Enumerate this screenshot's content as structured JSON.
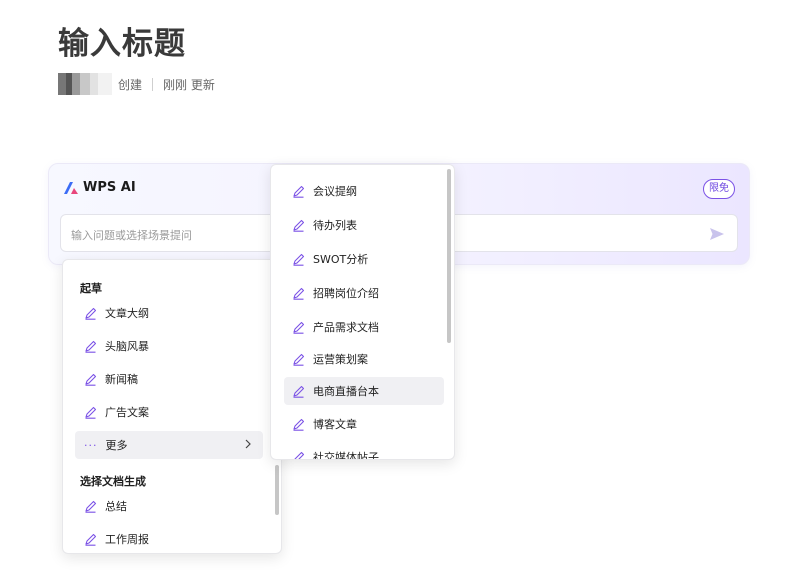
{
  "document": {
    "title": "输入标题",
    "created_label": "创建",
    "updated_label": "刚刚 更新"
  },
  "ai_panel": {
    "name": "WPS AI",
    "badge": "限免",
    "input_placeholder": "输入问题或选择场景提问",
    "logo_icon": "wps-ai-logo-icon",
    "send_icon": "send-arrow-icon",
    "accent_color": "#7b52e6"
  },
  "menu_left": {
    "section_draft": "起草",
    "draft_items": [
      "文章大纲",
      "头脑风暴",
      "新闻稿",
      "广告文案"
    ],
    "more_label": "更多",
    "section_doc": "选择文档生成",
    "doc_items": [
      "总结",
      "工作周报"
    ]
  },
  "menu_right": {
    "items": [
      "会议提纲",
      "待办列表",
      "SWOT分析",
      "招聘岗位介绍",
      "产品需求文档",
      "运营策划案",
      "电商直播台本",
      "博客文章",
      "社交媒体帖子"
    ],
    "hovered_item": "电商直播台本"
  }
}
